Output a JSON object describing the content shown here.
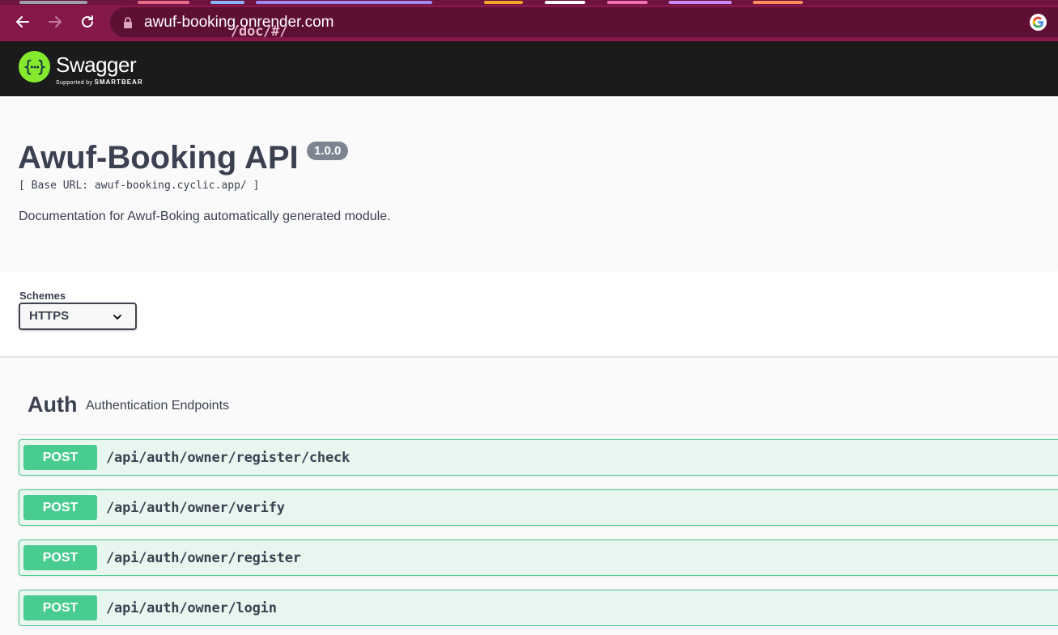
{
  "browser": {
    "url_host": "awuf-booking.onrender.com",
    "url_path": "/doc/#/",
    "tab_colors": [
      "#9aa0a6",
      "#e86c87",
      "#8ab4f8",
      "#9b8cf5",
      "#f5a623",
      "#ffffff",
      "#f36fb5",
      "#c98cf5",
      "#ff8a5c"
    ]
  },
  "header": {
    "logo_text": "Swagger",
    "logo_sub_prefix": "Supported by",
    "logo_sub_brand": "SMARTBEAR",
    "logo_icon": "swagger-braces-icon",
    "brand_color": "#85ea2d"
  },
  "info": {
    "title": "Awuf-Booking API",
    "version": "1.0.0",
    "base_url": "[ Base URL: awuf-booking.cyclic.app/ ]",
    "description": "Documentation for Awuf-Boking automatically generated module."
  },
  "schemes": {
    "label": "Schemes",
    "selected": "HTTPS"
  },
  "tags": [
    {
      "name": "Auth",
      "description": "Authentication Endpoints",
      "operations": [
        {
          "method": "POST",
          "path": "/api/auth/owner/register/check"
        },
        {
          "method": "POST",
          "path": "/api/auth/owner/verify"
        },
        {
          "method": "POST",
          "path": "/api/auth/owner/register"
        },
        {
          "method": "POST",
          "path": "/api/auth/owner/login"
        }
      ]
    }
  ],
  "colors": {
    "post": "#49cc90",
    "post_bg": "#e8f6f0",
    "text": "#3b4151",
    "chrome": "#84184a"
  }
}
